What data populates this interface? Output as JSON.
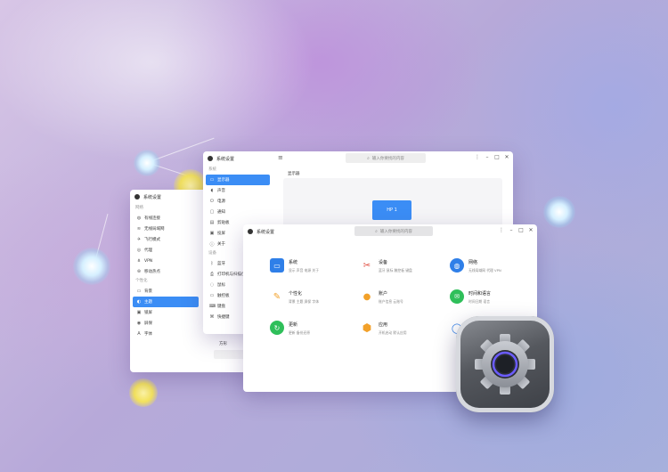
{
  "win_back": {
    "title": "系统设置",
    "sidebar": [
      {
        "section": "网络",
        "items": [
          {
            "icon": "globe-icon",
            "label": "有线连接"
          },
          {
            "icon": "wifi-icon",
            "label": "无线局域网"
          },
          {
            "icon": "airplane-icon",
            "label": "飞行模式"
          },
          {
            "icon": "proxy-icon",
            "label": "代理"
          },
          {
            "icon": "vpn-icon",
            "label": "VPN"
          },
          {
            "icon": "hotspot-icon",
            "label": "移动热点"
          }
        ]
      },
      {
        "section": "个性化",
        "items": [
          {
            "icon": "wallpaper-icon",
            "label": "背景"
          },
          {
            "icon": "theme-icon",
            "label": "主题",
            "active": true
          },
          {
            "icon": "lockscreen-icon",
            "label": "锁屏"
          },
          {
            "icon": "screensaver-icon",
            "label": "屏保"
          },
          {
            "icon": "font-icon",
            "label": "字体"
          }
        ]
      }
    ],
    "content_label": "方形"
  },
  "win_mid": {
    "title": "系统设置",
    "search_placeholder": "输入你要找的内容",
    "sidebar": [
      {
        "section": "系统",
        "items": [
          {
            "icon": "display-icon",
            "label": "显示器",
            "active": true
          },
          {
            "icon": "sound-icon",
            "label": "声音"
          },
          {
            "icon": "power-icon",
            "label": "电源"
          },
          {
            "icon": "touch-icon",
            "label": "通知"
          },
          {
            "icon": "multitask-icon",
            "label": "剪贴板"
          },
          {
            "icon": "monitor-icon",
            "label": "投屏"
          },
          {
            "icon": "info-icon",
            "label": "关于"
          }
        ]
      },
      {
        "section": "设备",
        "items": [
          {
            "icon": "bluetooth-icon",
            "label": "蓝牙"
          },
          {
            "icon": "printer-icon",
            "label": "打印机与扫描仪"
          },
          {
            "icon": "mouse-icon",
            "label": "鼠标"
          },
          {
            "icon": "touchpad-icon",
            "label": "触控板"
          },
          {
            "icon": "keyboard-icon",
            "label": "键盘"
          },
          {
            "icon": "shortcut-icon",
            "label": "快捷键"
          }
        ]
      }
    ],
    "content_heading": "显示器",
    "monitor_label": "HP 1"
  },
  "win_front": {
    "title": "系统设置",
    "search_placeholder": "输入你要找的内容",
    "categories": [
      {
        "icon": "system-monitor-icon",
        "color": "#2f7fe8",
        "title": "系统",
        "subtitle": "显示  声音  电源  关于"
      },
      {
        "icon": "devices-tools-icon",
        "color": "#e0473a",
        "title": "设备",
        "subtitle": "蓝牙  鼠标  触控板  键盘"
      },
      {
        "icon": "network-globe-icon",
        "color": "#2f7fe8",
        "title": "网络",
        "subtitle": "无线局域网  代理  VPN"
      },
      {
        "icon": "personalize-brush-icon",
        "color": "#f2a12a",
        "title": "个性化",
        "subtitle": "背景  主题  屏保  字体"
      },
      {
        "icon": "account-user-icon",
        "color": "#f2a12a",
        "title": "账户",
        "subtitle": "账户信息  云账号"
      },
      {
        "icon": "language-chat-icon",
        "color": "#2fbf5a",
        "title": "时间和语言",
        "subtitle": "时间日期  语言"
      },
      {
        "icon": "update-refresh-icon",
        "color": "#2fbf5a",
        "title": "更新",
        "subtitle": "更新  备份还原"
      },
      {
        "icon": "apps-hexagon-icon",
        "color": "#f2a12a",
        "title": "应用",
        "subtitle": "开机启动  默认应用"
      },
      {
        "icon": "search-circle-icon",
        "color": "#2f7fe8",
        "title": "",
        "subtitle": ""
      }
    ]
  },
  "colors": {
    "accent": "#3b8df5"
  }
}
